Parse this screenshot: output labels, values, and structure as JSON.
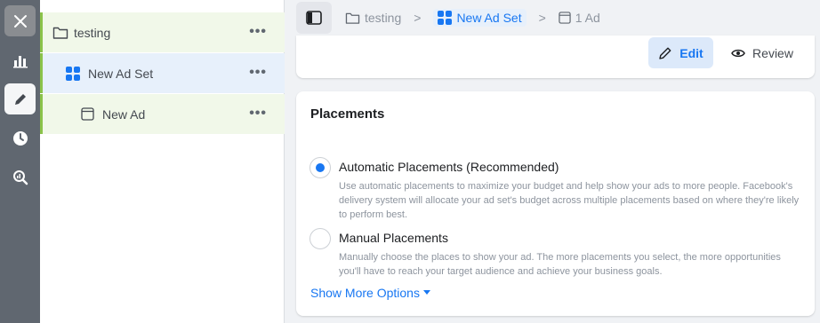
{
  "rail": {
    "items": [
      {
        "icon": "close-icon"
      },
      {
        "icon": "bar-chart-icon"
      },
      {
        "icon": "pencil-icon"
      },
      {
        "icon": "clock-icon"
      },
      {
        "icon": "search-data-icon"
      }
    ]
  },
  "tree": {
    "campaign": {
      "label": "testing",
      "more": "•••"
    },
    "adset": {
      "label": "New Ad Set",
      "more": "•••"
    },
    "ad": {
      "label": "New Ad",
      "more": "•••"
    }
  },
  "breadcrumb": {
    "campaign": "testing",
    "adset": "New Ad Set",
    "ad": "1 Ad",
    "separator": ">"
  },
  "actions": {
    "edit_label": "Edit",
    "review_label": "Review"
  },
  "placements": {
    "title": "Placements",
    "options": [
      {
        "label": "Automatic Placements (Recommended)",
        "description": "Use automatic placements to maximize your budget and help show your ads to more people. Facebook's delivery system will allocate your ad set's budget across multiple placements based on where they're likely to perform best.",
        "selected": true
      },
      {
        "label": "Manual Placements",
        "description": "Manually choose the places to show your ad. The more placements you select, the more opportunities you'll have to reach your target audience and achieve your business goals.",
        "selected": false
      }
    ],
    "more_options": "Show More Options"
  },
  "colors": {
    "accent": "#1877f2",
    "rail": "#606770",
    "tree_green": "#8bc34a"
  }
}
